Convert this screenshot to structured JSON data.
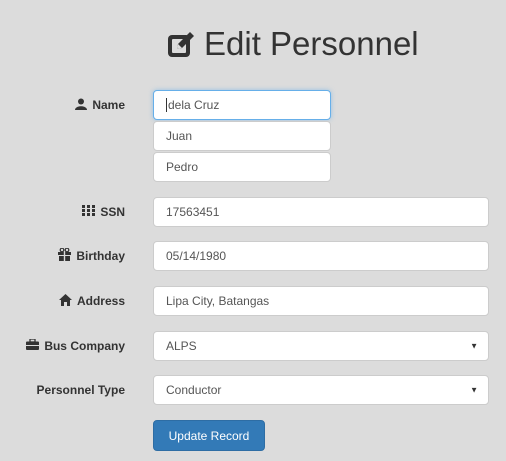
{
  "title": {
    "text": "Edit Personnel",
    "icon": "edit-icon"
  },
  "fields": {
    "name": {
      "label": "Name",
      "icon": "user-icon",
      "last": "dela Cruz",
      "first": "Juan",
      "middle": "Pedro"
    },
    "ssn": {
      "label": "SSN",
      "icon": "barcode-icon",
      "value": "17563451"
    },
    "birthday": {
      "label": "Birthday",
      "icon": "gift-icon",
      "value": "05/14/1980"
    },
    "address": {
      "label": "Address",
      "icon": "home-icon",
      "value": "Lipa City, Batangas"
    },
    "bus_company": {
      "label": "Bus Company",
      "icon": "briefcase-icon",
      "value": "ALPS"
    },
    "personnel_type": {
      "label": "Personnel Type",
      "value": "Conductor"
    }
  },
  "button": {
    "label": "Update Record",
    "color": "#337ab7"
  },
  "colors": {
    "background": "#dcdcdc",
    "focus": "#66afe9"
  }
}
